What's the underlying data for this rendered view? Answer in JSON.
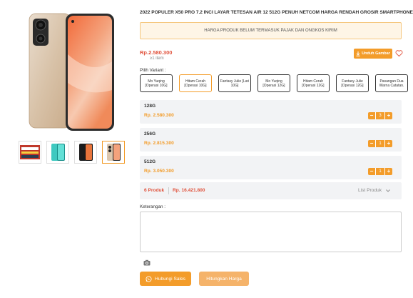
{
  "product": {
    "title": "2022 POPULER X50 PRO 7.2 INCI LAYAR TETESAN AIR 12 512G PENUH NETCOM HARGA RENDAH GROSIR SMARTPHONE",
    "notice": "HARGA PRODUK BELUM TERMASUK PAJAK DAN ONGKOS KIRIM",
    "price": "Rp.2.580.300",
    "min_item": "≥1 item",
    "download_label": "Unduh Gambar",
    "variant_label": "Pilih Variant :"
  },
  "gallery": {
    "thumbs": [
      "thumb-banner",
      "thumb-teal-phone",
      "thumb-black-phone",
      "thumb-gold-phone"
    ],
    "active_index": 3
  },
  "variants": [
    {
      "label": "Mo Yuqing [Operasi 10G]",
      "active": false
    },
    {
      "label": "Hitam Cerah [Operasi 10G]",
      "active": true
    },
    {
      "label": "Fantasy Julie [Lari 10G]",
      "active": false
    },
    {
      "label": "Mo Yuqing [Operasi 12G]",
      "active": false
    },
    {
      "label": "Hitam Cerah [Operasi 12G]",
      "active": false
    },
    {
      "label": "Fantasy Julie [Operasi 12G]",
      "active": false
    },
    {
      "label": "Pasangan Dua Warna Catatan.",
      "active": false
    }
  ],
  "rows": [
    {
      "name": "128G",
      "price": "Rp. 2.580.300",
      "qty": "3"
    },
    {
      "name": "256G",
      "price": "Rp. 2.815.300",
      "qty": "1"
    },
    {
      "name": "512G",
      "price": "Rp. 3.050.300",
      "qty": "1"
    }
  ],
  "summary": {
    "count": "6 Produk",
    "total": "Rp. 16.421.800",
    "list_label": "List Produk",
    "chevron": "chevron-down-icon"
  },
  "notes": {
    "label": "Keterangan :",
    "value": ""
  },
  "actions": {
    "sales_label": "Hubungi Sales",
    "calc_label": "Hitungkan Harga"
  },
  "colors": {
    "accent": "#f39c2a",
    "price_red": "#e0523c",
    "accent_light": "#f5b36a"
  }
}
